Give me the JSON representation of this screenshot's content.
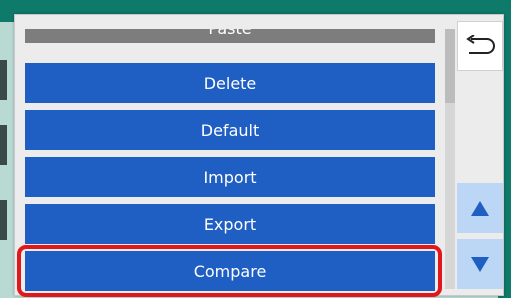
{
  "menu": {
    "items": [
      {
        "label": "Paste"
      },
      {
        "label": "Delete"
      },
      {
        "label": "Default"
      },
      {
        "label": "Import"
      },
      {
        "label": "Export"
      },
      {
        "label": "Compare"
      }
    ],
    "highlighted_item": "Compare"
  },
  "controls": {
    "back_icon": "return-arrow-icon",
    "scroll_up_icon": "triangle-up-icon",
    "scroll_down_icon": "triangle-down-icon"
  },
  "colors": {
    "item_bg": "#1f5ec2",
    "highlight": "#e2171b",
    "arrow_btn_bg": "#bcd6f5"
  }
}
